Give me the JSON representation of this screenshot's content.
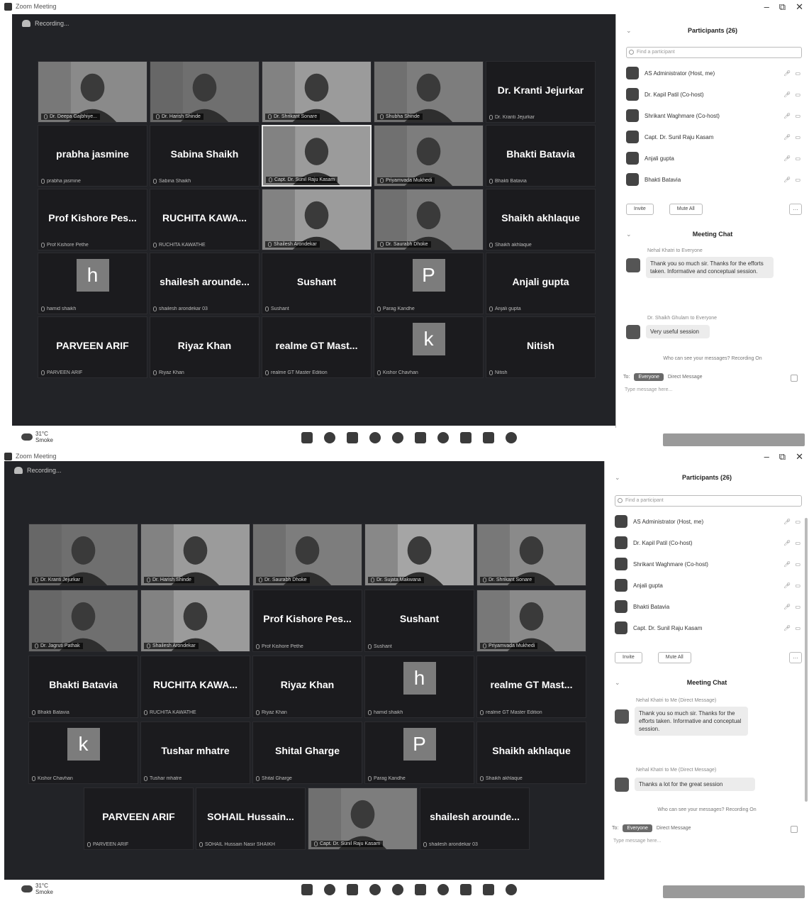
{
  "shot1": {
    "window_title": "Zoom Meeting",
    "recording": "Recording...",
    "tiles": [
      {
        "name": "",
        "label": "Dr. Deepa Gajbhiye...",
        "photo": true
      },
      {
        "name": "",
        "label": "Dr. Harish Shinde",
        "photo": true
      },
      {
        "name": "",
        "label": "Dr. Shrikant Sonare",
        "photo": true
      },
      {
        "name": "",
        "label": "Shubha Shinde",
        "photo": true
      },
      {
        "name": "Dr. Kranti Jejurkar",
        "label": "Dr. Kranti Jejurkar"
      },
      {
        "name": "prabha jasmine",
        "label": "prabha jasmine"
      },
      {
        "name": "Sabina Shaikh",
        "label": "Sabina Shaikh"
      },
      {
        "name": "",
        "label": "Capt. Dr. Sunil Raju Kasam",
        "photo": true,
        "active": true
      },
      {
        "name": "",
        "label": "Priyamvada Mukhedi",
        "photo": true
      },
      {
        "name": "Bhakti Batavia",
        "label": "Bhakti Batavia"
      },
      {
        "name": "Prof Kishore Pes...",
        "label": "Prof Kishore Pethe"
      },
      {
        "name": "RUCHITA KAWA...",
        "label": "RUCHITA KAWATHE"
      },
      {
        "name": "",
        "label": "Shailesh Arondekar",
        "photo": true
      },
      {
        "name": "",
        "label": "Dr. Saurabh Dhoke",
        "photo": true
      },
      {
        "name": "Shaikh akhlaque",
        "label": "Shaikh akhlaque"
      },
      {
        "name": "",
        "letter": "h",
        "label": "hamid shaikh"
      },
      {
        "name": "shailesh arounde...",
        "label": "shailesh arondekar 03"
      },
      {
        "name": "Sushant",
        "label": "Sushant"
      },
      {
        "name": "",
        "letter": "P",
        "label": "Parag Kandhe"
      },
      {
        "name": "Anjali gupta",
        "label": "Anjali gupta"
      },
      {
        "name": "PARVEEN ARIF",
        "label": "PARVEEN ARIF"
      },
      {
        "name": "Riyaz Khan",
        "label": "Riyaz Khan"
      },
      {
        "name": "realme GT Mast...",
        "label": "realme GT Master Edition"
      },
      {
        "name": "",
        "letter": "k",
        "label": "Kishor Chavhan"
      },
      {
        "name": "Nitish",
        "label": "Nitish"
      }
    ],
    "participants_title": "Participants (26)",
    "search_placeholder": "Find a participant",
    "participants": [
      "AS Administrator (Host, me)",
      "Dr. Kapil Patil (Co-host)",
      "Shrikant Waghmare (Co-host)",
      "Capt. Dr. Sunil Raju Kasam",
      "Anjali gupta",
      "Bhakti Batavia"
    ],
    "invite": "Invite",
    "mute_all": "Mute All",
    "chat_title": "Meeting Chat",
    "chat": [
      {
        "sender": "Nehal Khatri to Everyone",
        "text": "Thank you so much sir. Thanks for the efforts taken. Informative and conceptual session."
      },
      {
        "sender": "Dr. Shaikh Ghulam to Everyone",
        "text": "Very useful session"
      }
    ],
    "chat_notice": "Who can see your messages? Recording On",
    "chat_to_label": "To:",
    "chat_to_value": "Everyone",
    "chat_direct": "Direct Message",
    "chat_placeholder": "Type message here...",
    "weather_temp": "31°C",
    "weather_desc": "Smoke"
  },
  "shot2": {
    "window_title": "Zoom Meeting",
    "recording": "Recording...",
    "tiles": [
      {
        "name": "",
        "label": "Dr. Kranti Jejurkar",
        "photo": true
      },
      {
        "name": "",
        "label": "Dr. Harish Shinde",
        "photo": true
      },
      {
        "name": "",
        "label": "Dr. Saurabh Dhoke",
        "photo": true
      },
      {
        "name": "",
        "label": "Dr. Sujata Makwana",
        "photo": true
      },
      {
        "name": "",
        "label": "Dr. Shrikant Sonare",
        "photo": true
      },
      {
        "name": "",
        "label": "Dr. Jagruti Pathak",
        "photo": true
      },
      {
        "name": "",
        "label": "Shailesh Arondekar",
        "photo": true
      },
      {
        "name": "Prof Kishore Pes...",
        "label": "Prof Kishore Pethe"
      },
      {
        "name": "Sushant",
        "label": "Sushant"
      },
      {
        "name": "",
        "label": "Priyamvada Mukhedi",
        "photo": true
      },
      {
        "name": "Bhakti Batavia",
        "label": "Bhakti Batavia"
      },
      {
        "name": "RUCHITA KAWA...",
        "label": "RUCHITA KAWATHE"
      },
      {
        "name": "Riyaz Khan",
        "label": "Riyaz Khan"
      },
      {
        "name": "",
        "letter": "h",
        "label": "hamid shaikh"
      },
      {
        "name": "realme GT Mast...",
        "label": "realme GT Master Edition"
      },
      {
        "name": "",
        "letter": "k",
        "label": "Kishor Chavhan"
      },
      {
        "name": "Tushar mhatre",
        "label": "Tushar mhatre"
      },
      {
        "name": "Shital Gharge",
        "label": "Shital Gharge"
      },
      {
        "name": "",
        "letter": "P",
        "label": "Parag Kandhe"
      },
      {
        "name": "Shaikh akhlaque",
        "label": "Shaikh akhlaque"
      },
      {
        "name": "PARVEEN ARIF",
        "label": "PARVEEN ARIF"
      },
      {
        "name": "SOHAIL Hussain...",
        "label": "SOHAIL Hussain Nasir SHAIKH"
      },
      {
        "name": "",
        "label": "Capt. Dr. Sunil Raju Kasam",
        "photo": true
      },
      {
        "name": "shailesh arounde...",
        "label": "shailesh arondekar 03"
      }
    ],
    "participants_title": "Participants (26)",
    "search_placeholder": "Find a participant",
    "participants": [
      "AS Administrator (Host, me)",
      "Dr. Kapil Patil (Co-host)",
      "Shrikant Waghmare (Co-host)",
      "Anjali gupta",
      "Bhakti Batavia",
      "Capt. Dr. Sunil Raju Kasam"
    ],
    "invite": "Invite",
    "mute_all": "Mute All",
    "chat_title": "Meeting Chat",
    "chat": [
      {
        "sender": "Nehal Khatri to Me (Direct Message)",
        "text": "Thank you so much sir. Thanks for the efforts taken. Informative and conceptual session."
      },
      {
        "sender": "Nehal Khatri to Me (Direct Message)",
        "text": "Thanks a lot for the great session"
      }
    ],
    "chat_notice": "Who can see your messages? Recording On",
    "chat_to_label": "To:",
    "chat_to_value": "Everyone",
    "chat_direct": "Direct Message",
    "chat_placeholder": "Type message here...",
    "weather_temp": "31°C",
    "weather_desc": "Smoke"
  }
}
